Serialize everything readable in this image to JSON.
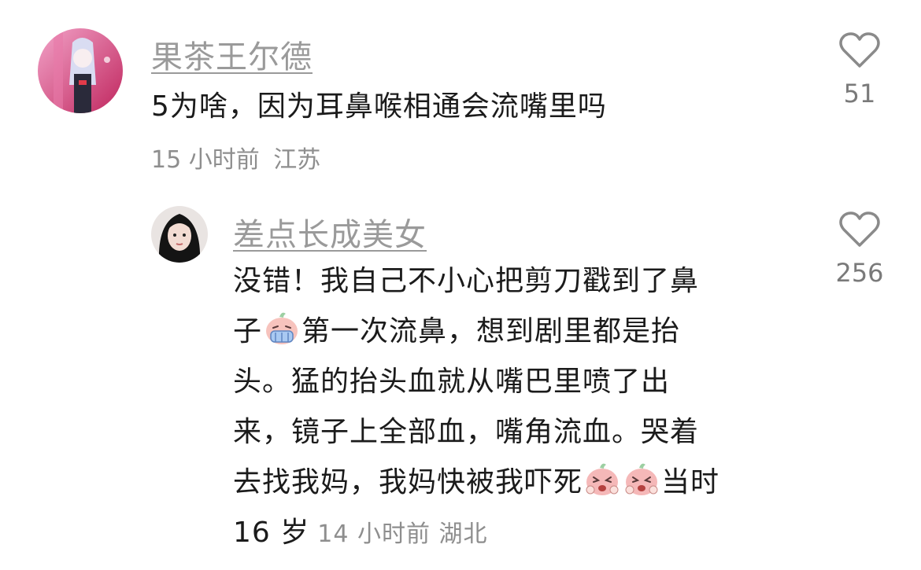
{
  "comments": [
    {
      "username": "果茶王尔德",
      "text": "5为啥，因为耳鼻喉相通会流嘴里吗",
      "time": "15 小时前",
      "location": "江苏",
      "likes": "51"
    }
  ],
  "reply": {
    "username": "差点长成美女",
    "lines": [
      "没错！我自己不小心把剪刀戳到了鼻",
      "子",
      "第一次流鼻，想到剧里都是抬",
      "头。猛的抬头血就从嘴巴里喷了出",
      "来，镜子上全部血，嘴角流血。哭着",
      "去找我妈，我妈快被我吓死",
      "当时",
      "16 岁"
    ],
    "time": "14 小时前",
    "location": "湖北",
    "likes": "256"
  },
  "icons": {
    "like": "heart-outline-icon",
    "emoji_cry": "crying-face-emoji",
    "emoji_scared": "scared-face-emoji"
  },
  "colors": {
    "username": "#9a9a9a",
    "text": "#1b1b1b",
    "meta": "#8e8e8e",
    "heart_stroke": "#8a8a8a"
  }
}
